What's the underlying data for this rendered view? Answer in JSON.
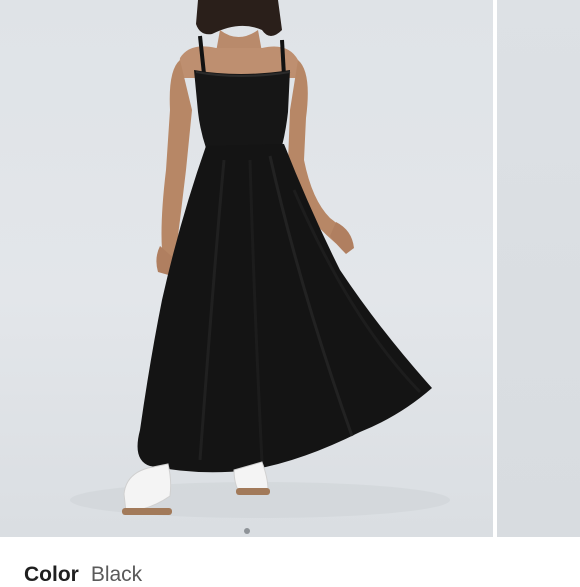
{
  "gallery": {
    "images": [
      {
        "subject": "model-black-maxi-dress",
        "active": true
      },
      {
        "subject": "next-image-partial",
        "active": false
      }
    ],
    "page_indicator_count": 1,
    "page_indicator_active": 1
  },
  "product": {
    "color_label": "Color",
    "color_value": "Black"
  },
  "colors": {
    "background": "#dfe3e7",
    "dress": "#141414",
    "text_dark": "#1f1f1f",
    "text_muted": "#5a5a5a"
  }
}
